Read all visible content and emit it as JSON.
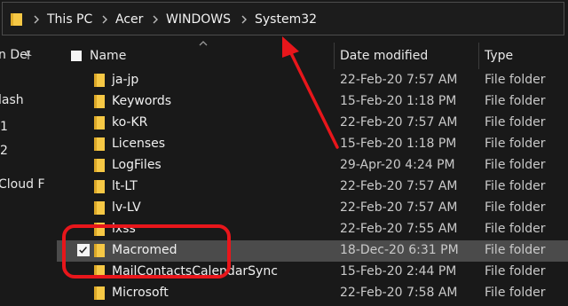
{
  "address_bar": {
    "crumbs": [
      "This PC",
      "Acer",
      "WINDOWS",
      "System32"
    ],
    "folder_icon": "folder-icon",
    "separator_icon": "chevron-right-icon"
  },
  "nav_pane": {
    "items": [
      "n De",
      "lash",
      "1",
      "2",
      "Cloud F"
    ],
    "pin_icon": "pin-icon"
  },
  "columns": {
    "name": "Name",
    "date": "Date modified",
    "type": "Type"
  },
  "files": [
    {
      "name": "ja-jp",
      "date": "22-Feb-20 7:57 AM",
      "type": "File folder"
    },
    {
      "name": "Keywords",
      "date": "15-Feb-20 1:18 PM",
      "type": "File folder"
    },
    {
      "name": "ko-KR",
      "date": "22-Feb-20 7:57 AM",
      "type": "File folder"
    },
    {
      "name": "Licenses",
      "date": "15-Feb-20 1:18 PM",
      "type": "File folder"
    },
    {
      "name": "LogFiles",
      "date": "29-Apr-20 4:24 PM",
      "type": "File folder"
    },
    {
      "name": "lt-LT",
      "date": "22-Feb-20 7:57 AM",
      "type": "File folder"
    },
    {
      "name": "lv-LV",
      "date": "22-Feb-20 7:57 AM",
      "type": "File folder"
    },
    {
      "name": "lxss",
      "date": "22-Feb-20 7:55 AM",
      "type": "File folder"
    },
    {
      "name": "Macromed",
      "date": "18-Dec-20 6:31 PM",
      "type": "File folder",
      "selected": true
    },
    {
      "name": "MailContactsCalendarSync",
      "date": "15-Feb-20 2:44 PM",
      "type": "File folder"
    },
    {
      "name": "Microsoft",
      "date": "22-Feb-20 7:58 AM",
      "type": "File folder"
    }
  ],
  "colors": {
    "background": "#191919",
    "selection": "#4b4b4b",
    "folder": "#f6c845",
    "annotation": "#e8161b"
  },
  "annotations": {
    "arrow": "red-arrow-pointing-to-system32",
    "highlight": "red-rounded-rectangle-around-macromed"
  }
}
